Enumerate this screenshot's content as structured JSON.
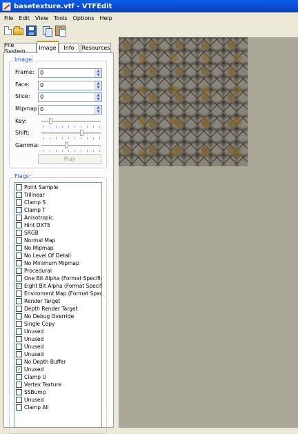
{
  "window": {
    "title": "basetexture.vtf - VTFEdit"
  },
  "menu": [
    "File",
    "Edit",
    "View",
    "Tools",
    "Options",
    "Help"
  ],
  "toolbar": {
    "icons": [
      "new-file-icon",
      "open-folder-icon",
      "save-disk-icon",
      "copy-icon",
      "paste-icon"
    ]
  },
  "tabs": [
    {
      "label": "File System",
      "active": false
    },
    {
      "label": "Image",
      "active": true
    },
    {
      "label": "Info",
      "active": false
    },
    {
      "label": "Resources",
      "active": false
    }
  ],
  "image_group": {
    "title": "Image:",
    "frame_label": "Frame:",
    "frame_value": "0",
    "face_label": "Face:",
    "face_value": "0",
    "slice_label": "Slice:",
    "slice_value": "0",
    "mipmap_label": "Mipmap:",
    "mipmap_value": "0",
    "key_label": "Key:",
    "shift_label": "Shift:",
    "gamma_label": "Gamma:",
    "play_label": "Play"
  },
  "flags_group": {
    "title": "Flags:",
    "items": [
      {
        "label": "Point Sample",
        "checked": false
      },
      {
        "label": "Trilinear",
        "checked": false
      },
      {
        "label": "Clamp S",
        "checked": false
      },
      {
        "label": "Clamp T",
        "checked": false
      },
      {
        "label": "Anisotropic",
        "checked": false
      },
      {
        "label": "Hint DXT5",
        "checked": false
      },
      {
        "label": "SRGB",
        "checked": false
      },
      {
        "label": "Normal Map",
        "checked": false
      },
      {
        "label": "No Mipmap",
        "checked": false
      },
      {
        "label": "No Level Of Detail",
        "checked": false
      },
      {
        "label": "No Minimum Mipmap",
        "checked": false
      },
      {
        "label": "Procedural",
        "checked": false
      },
      {
        "label": "One Bit Alpha (Format Specific)",
        "checked": false
      },
      {
        "label": "Eight Bit Alpha (Format Specific)",
        "checked": true
      },
      {
        "label": "Enviroment Map (Format Specific)",
        "checked": false
      },
      {
        "label": "Render Target",
        "checked": false
      },
      {
        "label": "Depth Render Target",
        "checked": false
      },
      {
        "label": "No Debug Override",
        "checked": false
      },
      {
        "label": "Single Copy",
        "checked": false
      },
      {
        "label": "Unused",
        "checked": false
      },
      {
        "label": "Unused",
        "checked": false
      },
      {
        "label": "Unused",
        "checked": false
      },
      {
        "label": "Unused",
        "checked": false
      },
      {
        "label": "No Depth Buffer",
        "checked": false
      },
      {
        "label": "Unused",
        "checked": true
      },
      {
        "label": "Clamp U",
        "checked": false
      },
      {
        "label": "Vertex Texture",
        "checked": false
      },
      {
        "label": "SSBump",
        "checked": false
      },
      {
        "label": "Unused",
        "checked": false
      },
      {
        "label": "Clamp All",
        "checked": false
      }
    ]
  },
  "colors": {
    "titlebar": "#0b4fd9",
    "group_title": "#2250c8",
    "preview_background": "#aca899",
    "check": "#21a121"
  }
}
